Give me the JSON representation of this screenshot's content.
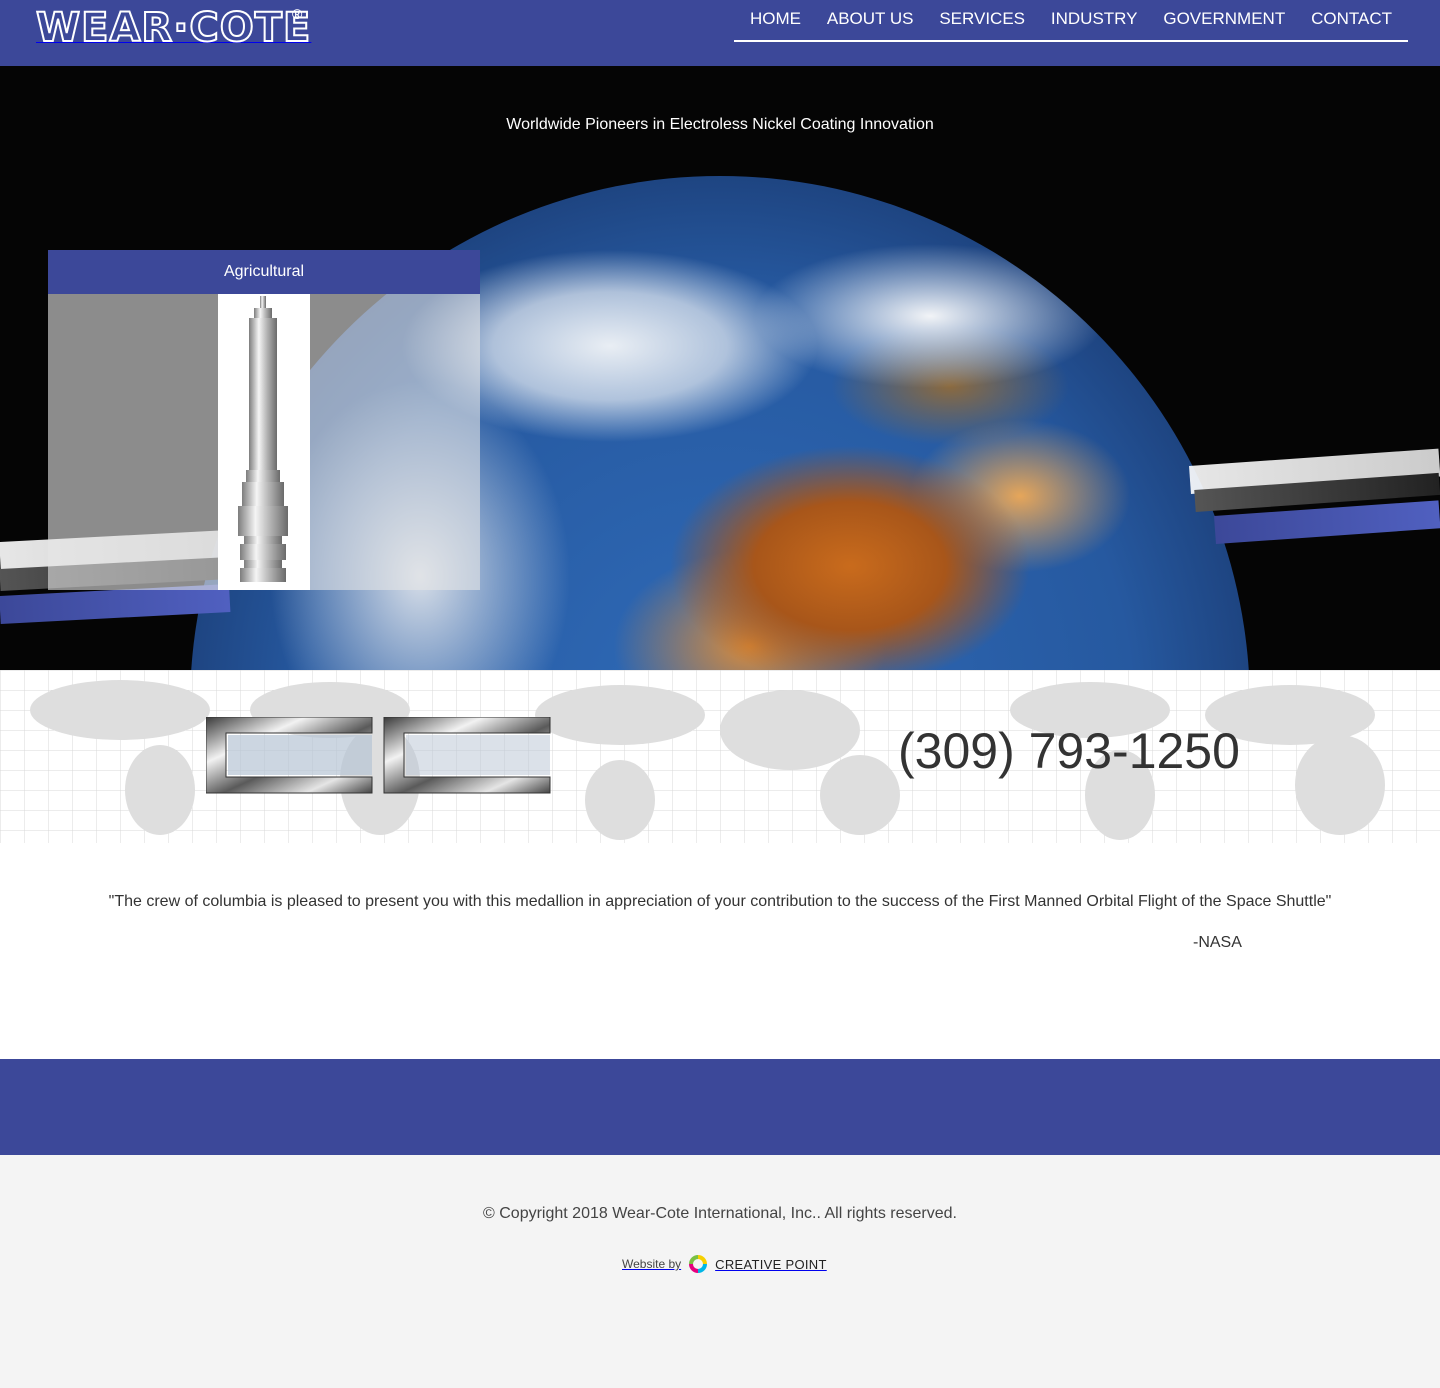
{
  "header": {
    "logo_text": "WEAR·COTE",
    "logo_reg": "®",
    "nav": [
      {
        "label": "HOME"
      },
      {
        "label": "ABOUT US"
      },
      {
        "label": "SERVICES"
      },
      {
        "label": "INDUSTRY"
      },
      {
        "label": "GOVERNMENT"
      },
      {
        "label": "CONTACT"
      }
    ]
  },
  "hero": {
    "tagline": "Worldwide Pioneers in Electroless Nickel Coating Innovation",
    "slider": {
      "title": "Agricultural"
    }
  },
  "band": {
    "phone": "(309) 793-1250"
  },
  "quote": {
    "text": "\"The crew of columbia is pleased to present you with this medallion in appreciation of your contribution to the success of the First Manned Orbital Flight of the Space Shuttle\"",
    "author": "-NASA"
  },
  "footer": {
    "copyright": "© Copyright 2018 Wear-Cote International, Inc.. All rights reserved.",
    "credit_label": "Website by",
    "credit_name": "CREATIVE  POINT"
  },
  "colors": {
    "brand_blue": "#3c4899",
    "footer_bg": "#f4f4f4"
  }
}
